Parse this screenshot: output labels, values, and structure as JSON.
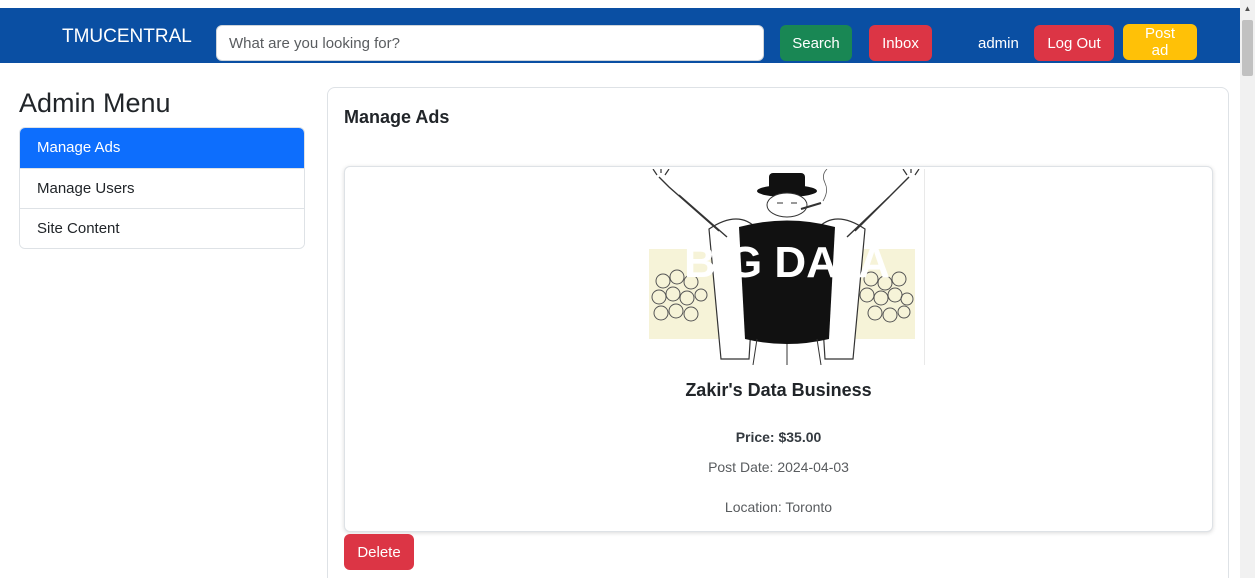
{
  "navbar": {
    "brand": "TMUCENTRAL",
    "search_placeholder": "What are you looking for?",
    "search_label": "Search",
    "inbox_label": "Inbox",
    "username": "admin",
    "logout_label": "Log Out",
    "post_ad_label": "Post ad",
    "colors": {
      "background": "#0a4fa3",
      "search": "#198754",
      "danger": "#dc3545",
      "warning": "#ffc107"
    }
  },
  "sidebar": {
    "title": "Admin Menu",
    "items": [
      {
        "label": "Manage Ads",
        "active": true
      },
      {
        "label": "Manage Users",
        "active": false
      },
      {
        "label": "Site Content",
        "active": false
      }
    ],
    "active_color": "#0d6efd"
  },
  "main": {
    "title": "Manage Ads",
    "ad": {
      "image_text": "BIG DATA",
      "title": "Zakir's Data Business",
      "price": "Price: $35.00",
      "post_date": "Post Date: 2024-04-03",
      "location": "Location: Toronto"
    },
    "delete_label": "Delete"
  },
  "icons": {
    "scroll_up": "scroll-up-arrow-icon"
  }
}
